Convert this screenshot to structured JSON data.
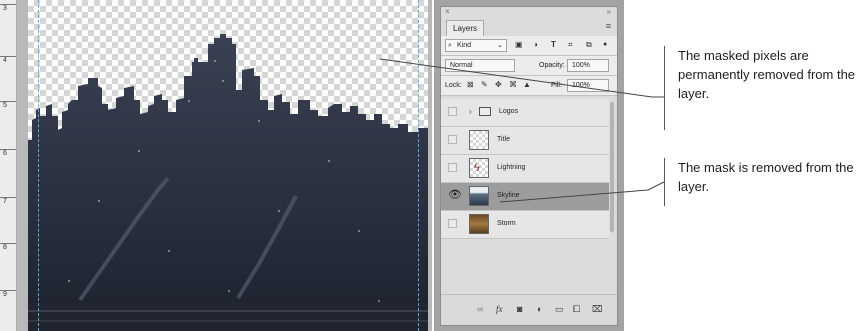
{
  "ruler": {
    "marks": [
      "3",
      "4",
      "5",
      "6",
      "7",
      "8",
      "9"
    ]
  },
  "panel": {
    "close_glyph": "×",
    "collapse_glyph": "»",
    "tab_label": "Layers",
    "menu_glyph": "≡",
    "filter_value": "Kind",
    "blend_mode": "Normal",
    "opacity_label": "Opacity:",
    "opacity_value": "100%",
    "lock_label": "Lock:",
    "fill_label": "Fill:",
    "fill_value": "100%",
    "filter_icons": [
      "image-filter-icon",
      "adjustment-filter-icon",
      "type-filter-icon",
      "shape-filter-icon",
      "smart-object-filter-icon"
    ],
    "layers": [
      {
        "name": "Logos",
        "kind": "group",
        "visible": false,
        "selected": false
      },
      {
        "name": "Title",
        "kind": "transparent",
        "visible": false,
        "selected": false
      },
      {
        "name": "Lightning",
        "kind": "lightning",
        "visible": false,
        "selected": false
      },
      {
        "name": "Skyline",
        "kind": "skyline",
        "visible": true,
        "selected": true
      },
      {
        "name": "Storm",
        "kind": "storm",
        "visible": false,
        "selected": false
      }
    ],
    "footer_icons": [
      "link-layers-icon",
      "fx-icon",
      "add-mask-icon",
      "adjustment-layer-icon",
      "new-group-icon",
      "new-layer-icon",
      "delete-layer-icon"
    ]
  },
  "annotations": [
    {
      "text": "The masked pixels are permanently removed from the layer."
    },
    {
      "text": "The mask is removed from the layer."
    }
  ]
}
